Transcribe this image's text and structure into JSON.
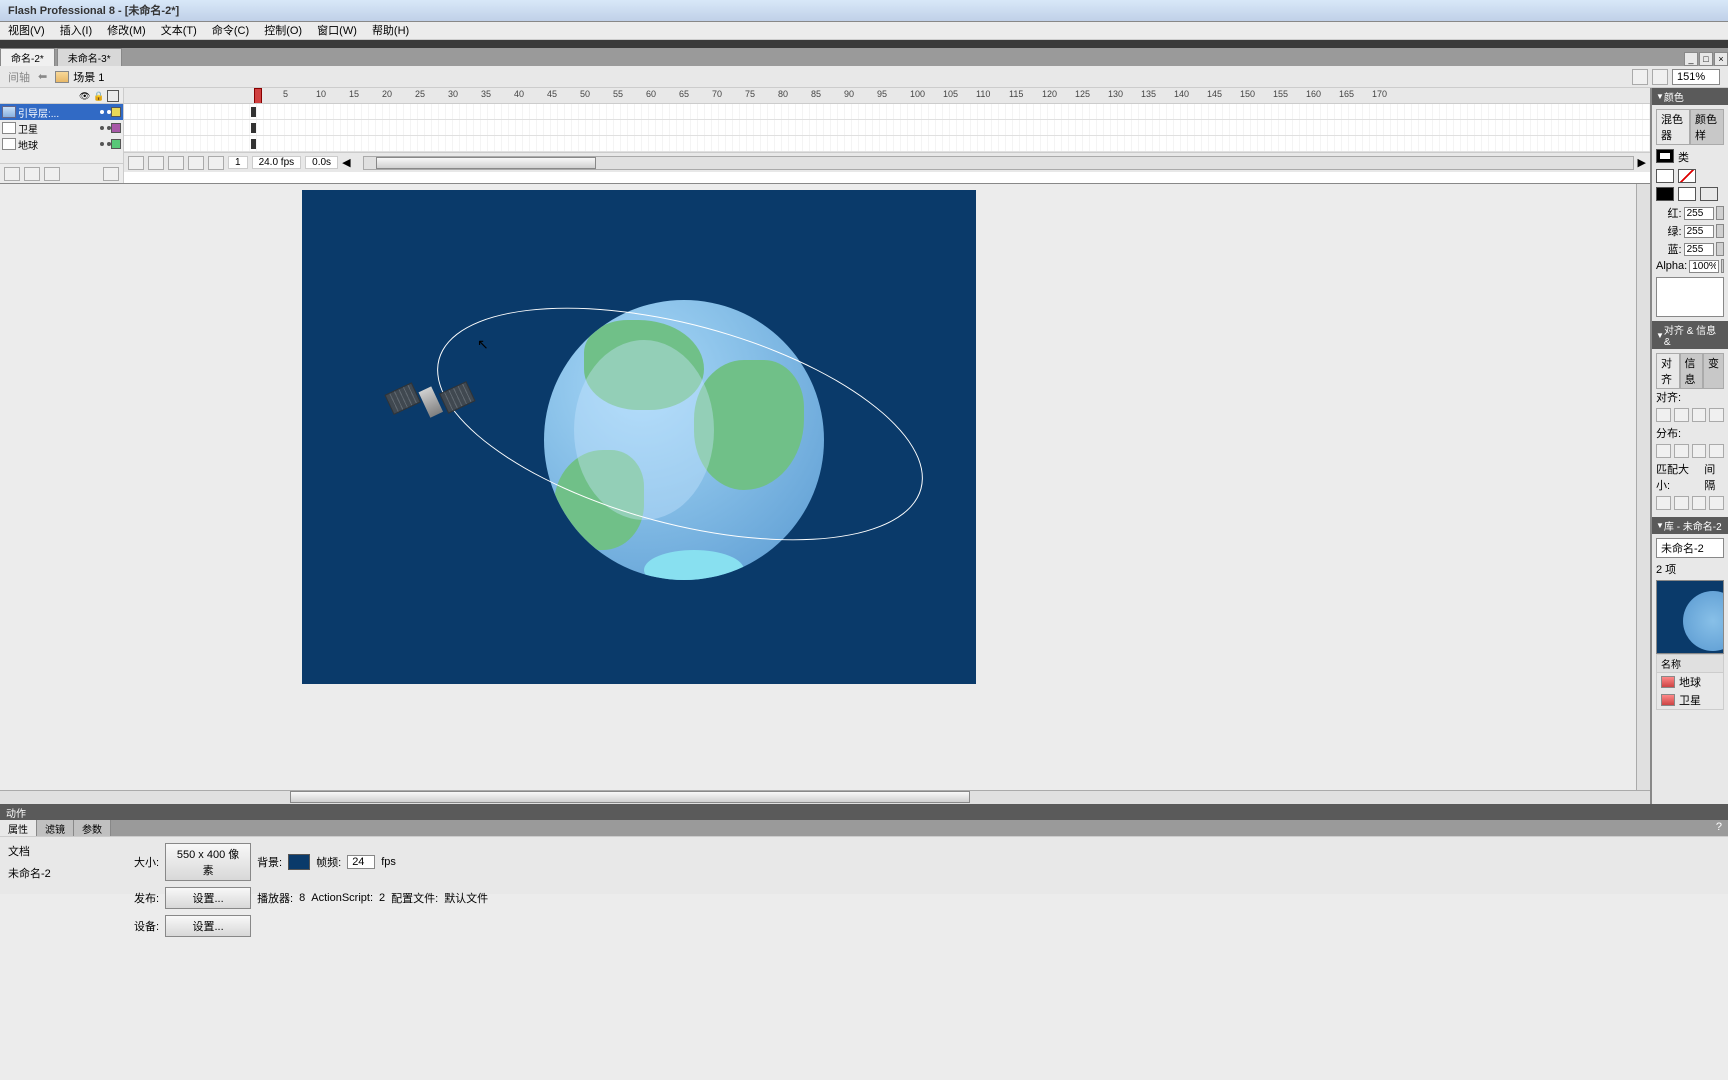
{
  "app": {
    "title": "Flash Professional 8 - [未命名-2*]"
  },
  "menu": {
    "view": "视图(V)",
    "insert": "插入(I)",
    "modify": "修改(M)",
    "text": "文本(T)",
    "command": "命令(C)",
    "control": "控制(O)",
    "window": "窗口(W)",
    "help": "帮助(H)"
  },
  "tabs": {
    "doc1": "命名-2*",
    "doc2": "未命名-3*"
  },
  "scene": {
    "timeline_label": "间轴",
    "scene_label": "场景 1",
    "zoom": "151%"
  },
  "layers": {
    "guide": "引导层:...",
    "satellite": "卫星",
    "earth": "地球",
    "colors": {
      "guide": "#e8d858",
      "satellite": "#a858a8",
      "earth": "#58c878"
    }
  },
  "timeline_footer": {
    "frame": "1",
    "fps": "24.0 fps",
    "time": "0.0s"
  },
  "actions": {
    "label": "动作"
  },
  "props": {
    "tab1": "属性",
    "tab2": "滤镜",
    "tab3": "参数",
    "doc_label": "文档",
    "doc_name": "未命名-2",
    "size_label": "大小:",
    "size_value": "550 x 400 像素",
    "bg_label": "背景:",
    "rate_label": "帧频:",
    "rate_value": "24",
    "fps": "fps",
    "publish_label": "发布:",
    "settings_btn": "设置...",
    "player_label": "播放器:",
    "player_value": "8",
    "as_label": "ActionScript:",
    "as_value": "2",
    "profile_label": "配置文件:",
    "profile_value": "默认文件",
    "device_label": "设备:"
  },
  "panels": {
    "color_hdr": "颜色",
    "mixer": "混色器",
    "swatches_tab": "颜色样",
    "type_label": "类",
    "r_label": "红:",
    "g_label": "绿:",
    "b_label": "蓝:",
    "alpha_label": "Alpha:",
    "r": "255",
    "g": "255",
    "b": "255",
    "alpha": "100%",
    "align_hdr": "对齐 & 信息 &",
    "align_tab": "对齐",
    "info_tab": "信息",
    "trans_tab": "变",
    "align_label": "对齐:",
    "distrib_label": "分布:",
    "match_label": "匹配大小:",
    "gap_label": "间隔",
    "lib_hdr": "库 - 未命名-2",
    "lib_dropdown": "未命名-2",
    "lib_count": "2 项",
    "name_col": "名称",
    "item_earth": "地球",
    "item_satellite": "卫星"
  }
}
